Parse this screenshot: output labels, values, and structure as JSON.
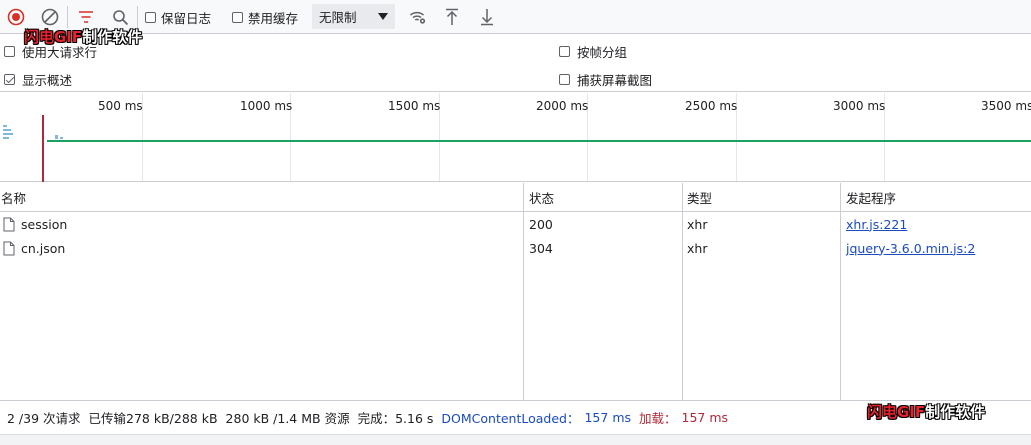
{
  "toolbar": {
    "preserve_log_label": "保留日志",
    "disable_cache_label": "禁用缓存",
    "throttle_value": "无限制"
  },
  "settings": {
    "large_rows_label": "使用大请求行",
    "show_overview_label": "显示概述",
    "group_by_frame_label": "按帧分组",
    "capture_screenshots_label": "捕获屏幕截图"
  },
  "watermark": {
    "text_a": "闪电GIF",
    "text_b": "制作软件"
  },
  "overview": {
    "ticks": [
      "500 ms",
      "1000 ms",
      "1500 ms",
      "2000 ms",
      "2500 ms",
      "3000 ms",
      "3500 ms"
    ]
  },
  "table": {
    "headers": [
      "名称",
      "状态",
      "类型",
      "发起程序"
    ],
    "rows": [
      {
        "name": "session",
        "status": "200",
        "type": "xhr",
        "initiator": "xhr.js:221"
      },
      {
        "name": "cn.json",
        "status": "304",
        "type": "xhr",
        "initiator": "jquery-3.6.0.min.js:2"
      }
    ]
  },
  "status_bar": {
    "requests": "2 /39 次请求",
    "transferred": "已传输278 kB/288 kB",
    "resources": "280 kB /1.4 MB 资源",
    "finish": "完成：5.16 s",
    "dcl_label": "DOMContentLoaded：",
    "dcl_value": "157 ms",
    "load_label": "加载：",
    "load_value": "157 ms"
  },
  "colors": {
    "record_red": "#d93025",
    "filter_red": "#d93025",
    "link_blue": "#1a4bbf",
    "timeline_green": "#1aa260",
    "load_red": "#b22838"
  }
}
